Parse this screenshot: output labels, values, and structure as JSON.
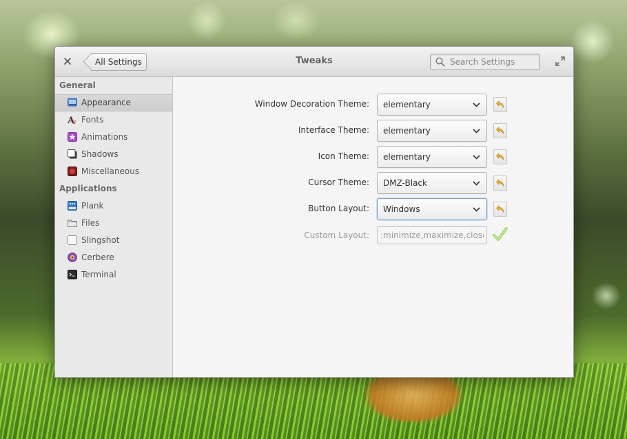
{
  "window": {
    "title": "Tweaks"
  },
  "titlebar": {
    "back_label": "All Settings",
    "search_placeholder": "Search Settings",
    "close_icon": "close-icon",
    "maximize_icon": "maximize-icon",
    "search_icon": "search-icon"
  },
  "sidebar": {
    "sections": [
      {
        "header": "General",
        "items": [
          {
            "label": "Appearance",
            "icon": "appearance-icon",
            "selected": true
          },
          {
            "label": "Fonts",
            "icon": "fonts-icon"
          },
          {
            "label": "Animations",
            "icon": "animations-icon"
          },
          {
            "label": "Shadows",
            "icon": "shadows-icon"
          },
          {
            "label": "Miscellaneous",
            "icon": "miscellaneous-icon"
          }
        ]
      },
      {
        "header": "Applications",
        "items": [
          {
            "label": "Plank",
            "icon": "plank-icon"
          },
          {
            "label": "Files",
            "icon": "files-icon"
          },
          {
            "label": "Slingshot",
            "icon": "slingshot-icon"
          },
          {
            "label": "Cerbere",
            "icon": "cerbere-icon"
          },
          {
            "label": "Terminal",
            "icon": "terminal-icon"
          }
        ]
      }
    ]
  },
  "settings": {
    "window_decoration": {
      "label": "Window Decoration Theme:",
      "value": "elementary"
    },
    "interface_theme": {
      "label": "Interface Theme:",
      "value": "elementary"
    },
    "icon_theme": {
      "label": "Icon Theme:",
      "value": "elementary"
    },
    "cursor_theme": {
      "label": "Cursor Theme:",
      "value": "DMZ-Black"
    },
    "button_layout": {
      "label": "Button Layout:",
      "value": "Windows"
    },
    "custom_layout": {
      "label": "Custom Layout:",
      "value": ":minimize,maximize,close"
    }
  },
  "colors": {
    "accent_focus": "#7aa3d1",
    "reset_icon": "#f0b429",
    "apply_check": "#9fd36a"
  }
}
